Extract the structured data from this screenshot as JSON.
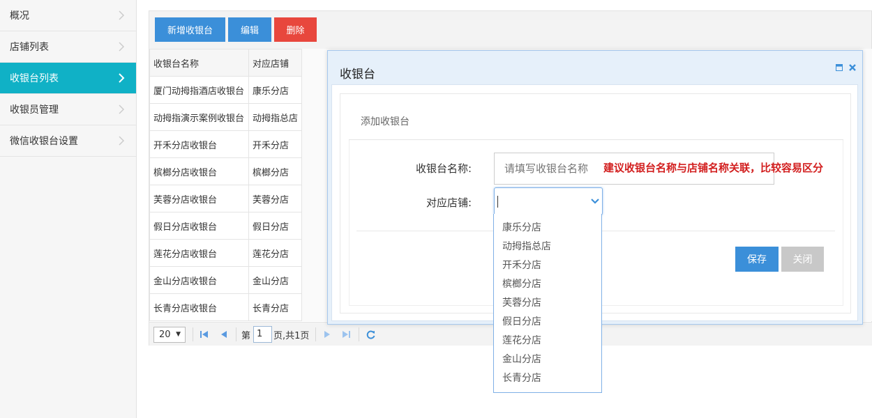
{
  "sidebar": {
    "items": [
      {
        "label": "概况",
        "active": false
      },
      {
        "label": "店铺列表",
        "active": false
      },
      {
        "label": "收银台列表",
        "active": true
      },
      {
        "label": "收银员管理",
        "active": false
      },
      {
        "label": "微信收银台设置",
        "active": false
      }
    ]
  },
  "toolbar": {
    "add_label": "新增收银台",
    "edit_label": "编辑",
    "delete_label": "删除"
  },
  "table": {
    "columns": [
      "收银台名称",
      "对应店铺"
    ],
    "rows": [
      [
        "厦门动拇指酒店收银台",
        "康乐分店"
      ],
      [
        "动拇指演示案例收银台",
        "动拇指总店"
      ],
      [
        "开禾分店收银台",
        "开禾分店"
      ],
      [
        "槟榔分店收银台",
        "槟榔分店"
      ],
      [
        "芙蓉分店收银台",
        "芙蓉分店"
      ],
      [
        "假日分店收银台",
        "假日分店"
      ],
      [
        "莲花分店收银台",
        "莲花分店"
      ],
      [
        "金山分店收银台",
        "金山分店"
      ],
      [
        "长青分店收银台",
        "长青分店"
      ]
    ]
  },
  "pager": {
    "page_size": "20",
    "page_prefix": "第",
    "page_value": "1",
    "page_suffix": "页,共1页"
  },
  "dialog": {
    "title": "收银台",
    "section_title": "添加收银台",
    "name_label": "收银台名称:",
    "name_placeholder": "请填写收银台名称",
    "name_hint": "建议收银台名称与店铺名称关联，比较容易区分",
    "store_label": "对应店铺:",
    "store_options": [
      "康乐分店",
      "动拇指总店",
      "开禾分店",
      "槟榔分店",
      "芙蓉分店",
      "假日分店",
      "莲花分店",
      "金山分店",
      "长青分店"
    ],
    "save_label": "保存",
    "close_label": "关闭"
  },
  "colors": {
    "accent_blue": "#3b8fd9",
    "danger_red": "#e8473d",
    "active_teal": "#10b1c6",
    "hint_red": "#d21e1e"
  }
}
